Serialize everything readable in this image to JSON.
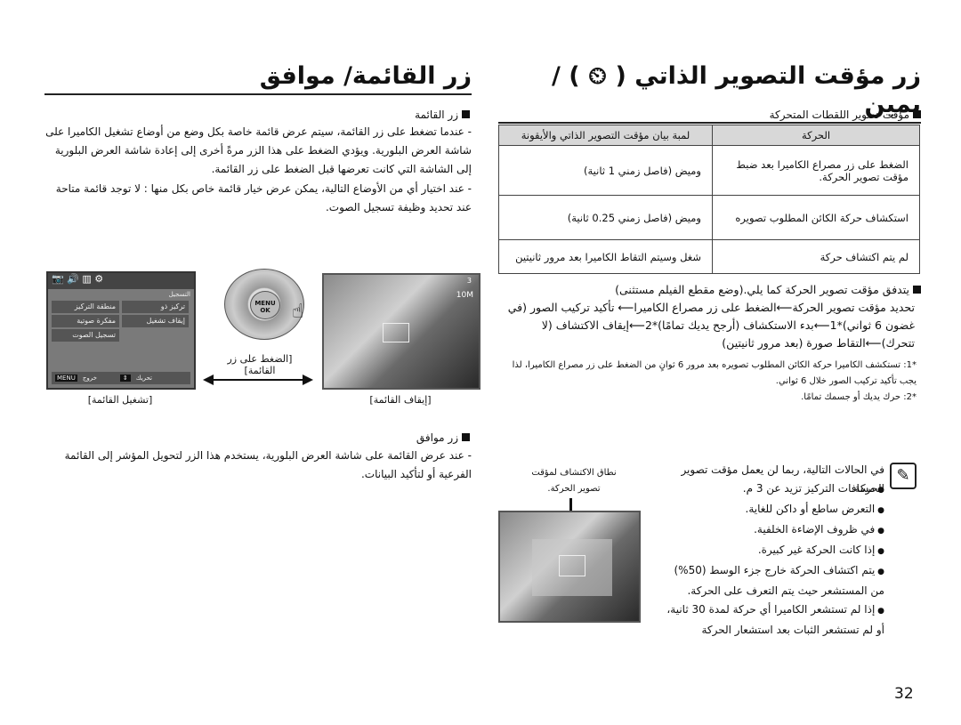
{
  "right": {
    "title": "زر مؤقت التصوير الذاتي ( ⏲ ) / يمين",
    "section1": "مؤقت تصوير اللقطات المتحركة",
    "table": {
      "headers": [
        "الحركة",
        "لمبة بيان مؤقت التصوير الذاتي والأيقونة"
      ],
      "rows": [
        [
          "الضغط على زر مصراع الكاميرا بعد ضبط مؤقت تصوير الحركة.",
          "وميض (فاصل زمني 1 ثانية)"
        ],
        [
          "استكشاف حركة الكائن المطلوب تصويره",
          "وميض (فاصل زمني 0.25 ثانية)"
        ],
        [
          "لم يتم اكتشاف حركة",
          "شغل وسيتم التقاط الكاميرا بعد مرور ثانيتين"
        ]
      ]
    },
    "section2": "يتدفق مؤقت تصوير الحركة كما يلي.(وضع مقطع الفيلم مستثنى)",
    "flow": "تحديد مؤقت تصوير الحركة⟵الضغط على زر مصراع الكاميرا⟵ تأكيد تركيب الصور (في غضون 6 ثواني)*1⟵بدء الاستكشاف (أرجح يديك تمامًا)*2⟵إيقاف الاكتشاف (لا تتحرك)⟵التقاط صورة (بعد مرور ثانيتين)",
    "footnote1": "*1: تستكشف الكاميرا حركة الكائن المطلوب تصويره بعد مرور 6 ثوانٍ من الضغط على زر مصراع الكاميرا، لذا يجب تأكيد تركيب الصور خلال 6 ثواني.",
    "footnote2": "*2: حرك يديك أو جسمك تمامًا.",
    "note_intro": "في الحالات التالية، ربما لن يعمل مؤقت تصوير الحركة.",
    "note_items": [
      "مسافات التركيز تزيد عن 3 م.",
      "التعرض ساطع أو داكن للغاية.",
      "في ظروف الإضاءة الخلفية.",
      "إذا كانت الحركة غير كبيرة.",
      "يتم اكتشاف الحركة خارج جزء الوسط (50%) من المستشعر حيث يتم التعرف على الحركة.",
      "إذا لم تستشعر الكاميرا أي حركة لمدة 30 ثانية، أو لم تستشعر الثبات بعد استشعار الحركة"
    ],
    "detect_caption": "نطاق الاكتشاف لمؤقت تصوير الحركة."
  },
  "left": {
    "title": "زر القائمة/ موافق",
    "section1": "زر القائمة",
    "para1": "- عندما تضغط على زر القائمة، سيتم عرض قائمة خاصة بكل وضع من أوضاع تشغيل الكاميرا على شاشة العرض البلورية. ويؤدي الضغط على هذا الزر مرةً أخرى إلى إعادة شاشة العرض البلورية إلى الشاشة التي كانت تعرضها قبل الضغط على زر القائمة.",
    "para2": "- عند اختيار أي من الأوضاع التالية، يمكن عرض خيار قائمة خاص بكل منها : لا توجد قائمة متاحة عند تحديد وظيفة تسجيل الصوت.",
    "menu_screen": {
      "tab": "التسجيل",
      "items": [
        "تركيز ذو",
        "إيقاف تشغيل",
        "منطقة التركيز",
        "مفكرة صوتية",
        "تسجيل الصوت"
      ],
      "exit_key": "MENU",
      "exit": "خروج",
      "move": "تحريك"
    },
    "dial": {
      "center": "MENU OK"
    },
    "press_caption": "[الضغط على زر القائمة]",
    "menu_on_caption": "[تشغيل القائمة]",
    "menu_off_caption": "[إيقاف القائمة]",
    "osd": {
      "count": "3",
      "size": "10M"
    },
    "section2": "زر موافق",
    "para3": "- عند عرض القائمة على شاشة العرض البلورية، يستخدم هذا الزر لتحويل المؤشر إلى القائمة الفرعية أو لتأكيد البيانات."
  },
  "page_number": "32"
}
